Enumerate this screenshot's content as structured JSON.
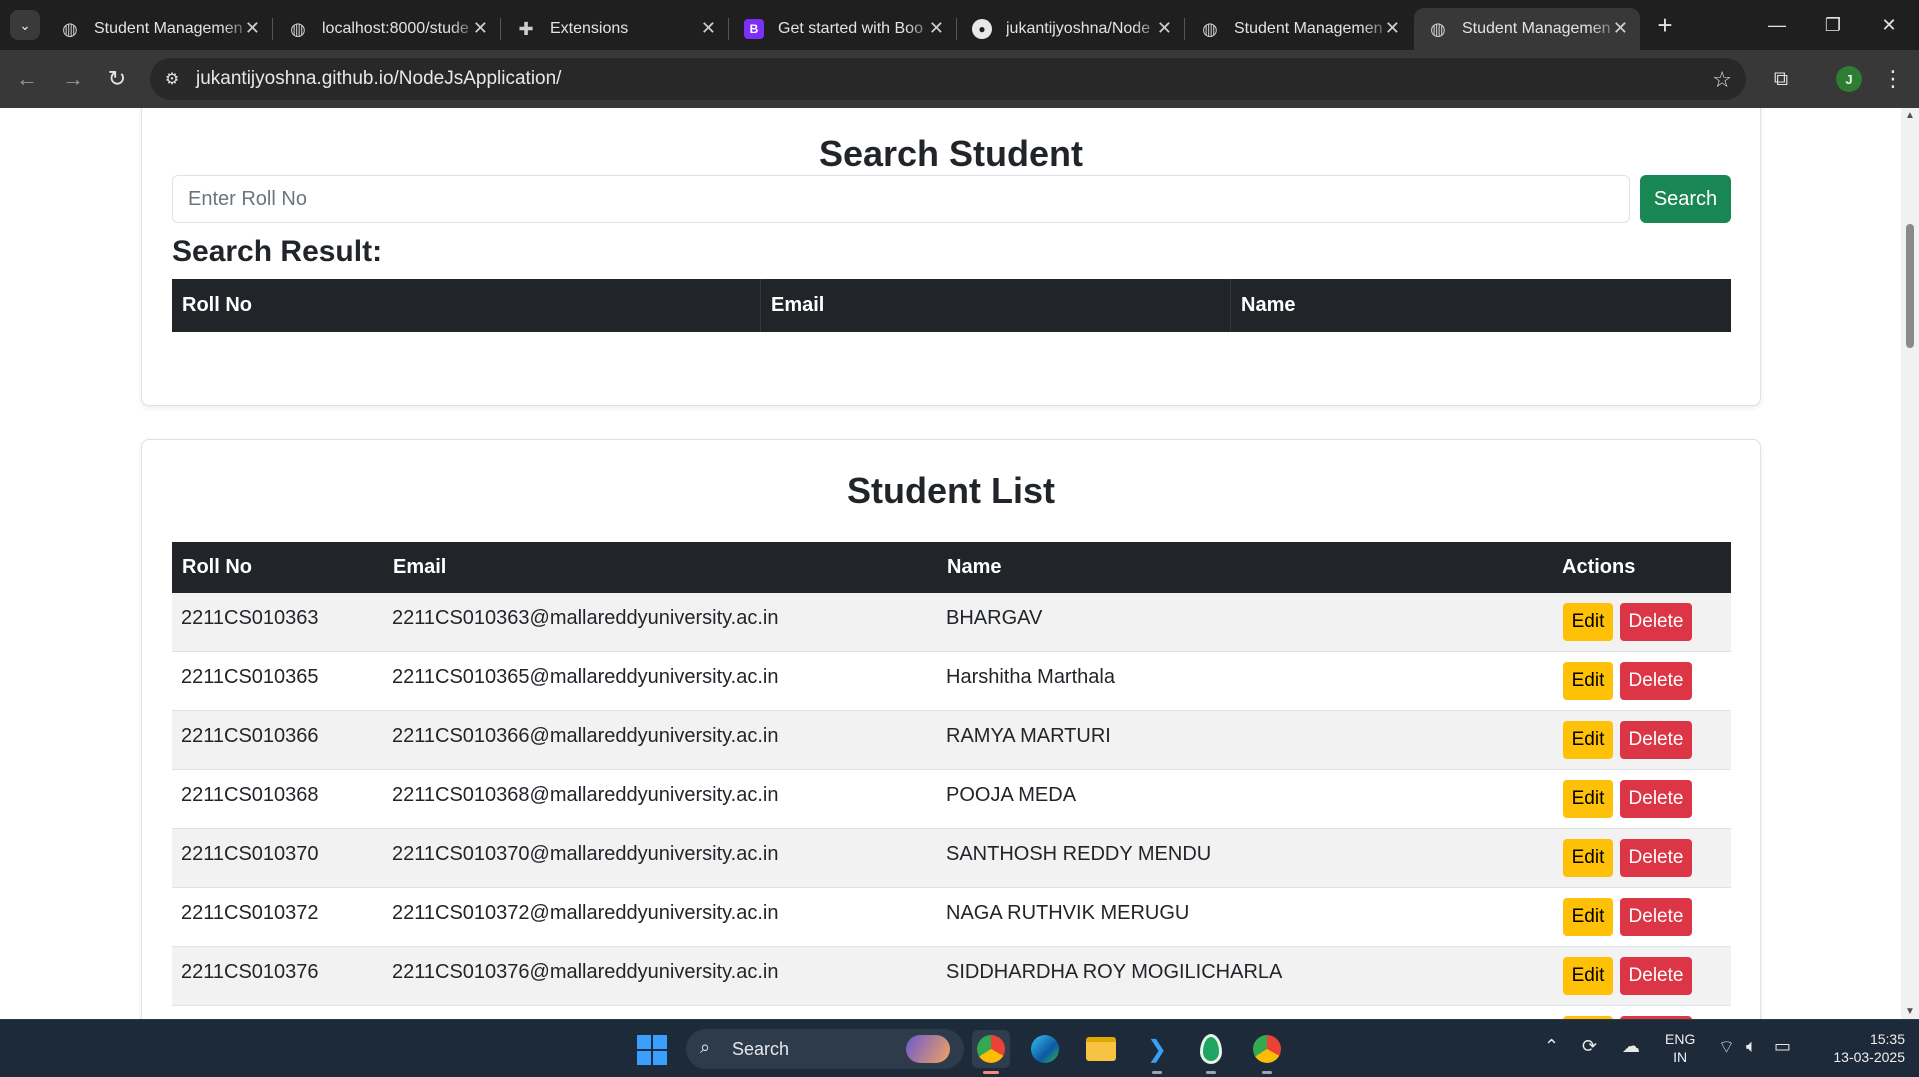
{
  "browser": {
    "tabs": [
      {
        "title": "Student Managemen",
        "icon": "globe-icon",
        "active": false
      },
      {
        "title": "localhost:8000/stude",
        "icon": "globe-icon",
        "active": false
      },
      {
        "title": "Extensions",
        "icon": "puzzle-icon",
        "active": false
      },
      {
        "title": "Get started with Boo",
        "icon": "bootstrap-icon",
        "active": false
      },
      {
        "title": "jukantijyoshna/Node",
        "icon": "github-icon",
        "active": false
      },
      {
        "title": "Student Managemen",
        "icon": "globe-icon",
        "active": false
      },
      {
        "title": "Student Managemen",
        "icon": "globe-icon",
        "active": true
      }
    ],
    "url": "jukantijyoshna.github.io/NodeJsApplication/",
    "profile_initial": "J"
  },
  "search_section": {
    "heading": "Search Student",
    "input_placeholder": "Enter Roll No",
    "input_value": "",
    "button_label": "Search",
    "result_label": "Search Result:",
    "result_columns": [
      "Roll No",
      "Email",
      "Name"
    ]
  },
  "list_section": {
    "heading": "Student List",
    "columns": [
      "Roll No",
      "Email",
      "Name",
      "Actions"
    ],
    "edit_label": "Edit",
    "delete_label": "Delete",
    "rows": [
      {
        "roll": "2211CS010363",
        "email": "2211CS010363@mallareddyuniversity.ac.in",
        "name": "BHARGAV"
      },
      {
        "roll": "2211CS010365",
        "email": "2211CS010365@mallareddyuniversity.ac.in",
        "name": "Harshitha Marthala"
      },
      {
        "roll": "2211CS010366",
        "email": "2211CS010366@mallareddyuniversity.ac.in",
        "name": "RAMYA MARTURI"
      },
      {
        "roll": "2211CS010368",
        "email": "2211CS010368@mallareddyuniversity.ac.in",
        "name": "POOJA MEDA"
      },
      {
        "roll": "2211CS010370",
        "email": "2211CS010370@mallareddyuniversity.ac.in",
        "name": "SANTHOSH REDDY MENDU"
      },
      {
        "roll": "2211CS010372",
        "email": "2211CS010372@mallareddyuniversity.ac.in",
        "name": "NAGA RUTHVIK MERUGU"
      },
      {
        "roll": "2211CS010376",
        "email": "2211CS010376@mallareddyuniversity.ac.in",
        "name": "SIDDHARDHA ROY MOGILICHARLA"
      }
    ]
  },
  "taskbar": {
    "search_label": "Search",
    "lang_top": "ENG",
    "lang_bottom": "IN",
    "time": "15:35",
    "date": "13-03-2025"
  },
  "colors": {
    "success": "#198754",
    "warning": "#ffc107",
    "danger": "#dc3545",
    "table_dark": "#212529"
  }
}
